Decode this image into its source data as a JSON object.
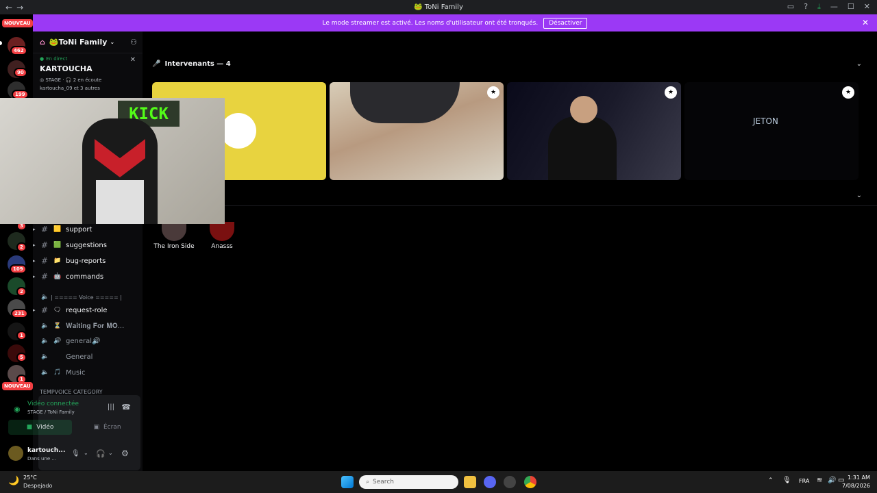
{
  "window": {
    "title": "ToNi Family"
  },
  "banner": {
    "text": "Le mode streamer est activé. Les noms d'utilisateur ont été tronqués.",
    "button": "Désactiver"
  },
  "guilds": {
    "new_label": "NOUVEAU",
    "badges": [
      "462",
      "90",
      "199",
      "3",
      "2",
      "109",
      "2",
      "231",
      "1",
      "5",
      "1"
    ]
  },
  "server": {
    "name": "ToNi Family"
  },
  "live": {
    "status": "En direct",
    "title": "KARTOUCHA",
    "stage": "STAGE",
    "listeners": "2 en écoute",
    "host": "kartoucha_09 et 3 autres"
  },
  "camera": {
    "sign": "KICK"
  },
  "channels": [
    {
      "emoji": "🟨",
      "name": "support"
    },
    {
      "emoji": "🟩",
      "name": "suggestions"
    },
    {
      "emoji": "📁",
      "name": "bug-reports"
    },
    {
      "emoji": "🤖",
      "name": "commands"
    }
  ],
  "voice_category": "| ===== Voice ===== |",
  "request_role": "request-role",
  "voice_channels": [
    {
      "emoji": "⏳",
      "name": "𝐖𝐚𝐢𝐭𝐢𝐧𝐠 𝐅𝐨𝐫 𝐌𝐎..."
    },
    {
      "emoji": "🔊",
      "name": "general🔊"
    },
    {
      "emoji": "",
      "name": "General"
    },
    {
      "emoji": "🎵",
      "name": "Music"
    }
  ],
  "temp_category": "TEMPVOICE CATEGORY",
  "voice_panel": {
    "status": "Vidéo connectée",
    "location": "STAGE / ToNi Family",
    "video_button": "Vidéo",
    "screen_button": "Écran"
  },
  "user": {
    "name": "kartouch...",
    "status": "Dans une ..."
  },
  "main": {
    "speakers_title": "Intervenants — 4",
    "audience": [
      {
        "name": "The Iron Side"
      },
      {
        "name": "Anasss"
      }
    ],
    "tile4_text": "JETON"
  },
  "taskbar": {
    "weather_temp": "25°C",
    "weather_desc": "Despejado",
    "search": "Search",
    "lang": "FRA",
    "time": "1:31 AM",
    "date": "7/08/2026"
  },
  "colors": {
    "banner": "#9b39f5",
    "accent_green": "#23a55a",
    "badge_red": "#f23f43",
    "tile_yellow": "#e8d33f"
  }
}
